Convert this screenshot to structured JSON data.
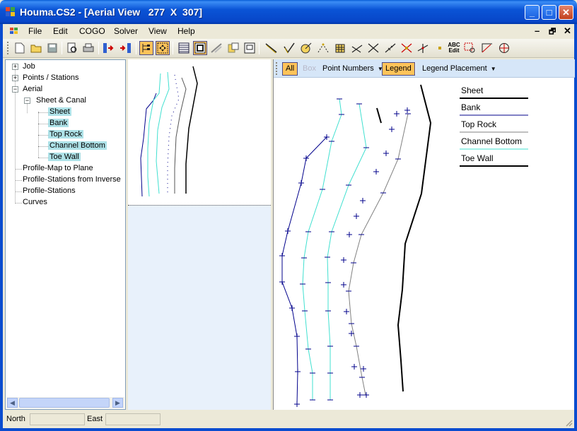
{
  "window": {
    "title": "Houma.CS2 - [Aerial View   277  X  307]",
    "controls": {
      "minimize": "_",
      "maximize": "□",
      "close": "✕"
    }
  },
  "menu": [
    "File",
    "Edit",
    "COGO",
    "Solver",
    "View",
    "Help"
  ],
  "mdi_controls": {
    "minimize": "–",
    "restore": "🗗",
    "close": "✕"
  },
  "toolbar_icons": [
    "new-icon",
    "open-icon",
    "save-icon",
    "print-preview-icon",
    "print-icon",
    "import-icon",
    "export-icon",
    "tree-view-icon",
    "extents-icon",
    "grid-icon",
    "aerial-icon",
    "profile-icon",
    "plan-icon",
    "window-icon",
    "line-icon",
    "check-icon",
    "compass-icon",
    "points-icon",
    "grid-point-icon",
    "angle-icon",
    "cross-icon",
    "measure-icon",
    "intersect-icon",
    "perpendicular-icon",
    "dot-icon",
    "edit-text-icon",
    "zoom-window-icon",
    "arc-icon",
    "circle-icon"
  ],
  "tree": {
    "items": [
      {
        "label": "Job",
        "expander": "+"
      },
      {
        "label": "Points / Stations",
        "expander": "+"
      },
      {
        "label": "Aerial",
        "expander": "−"
      },
      {
        "label": "Sheet & Canal",
        "expander": "−"
      },
      {
        "label": "Sheet",
        "selected": true
      },
      {
        "label": "Bank",
        "selected": true
      },
      {
        "label": "Top Rock",
        "selected": true
      },
      {
        "label": "Channel Bottom",
        "selected": true
      },
      {
        "label": "Toe Wall",
        "selected": true
      },
      {
        "label": "Profile-Map to Plane"
      },
      {
        "label": "Profile-Stations from Inverse"
      },
      {
        "label": "Profile-Stations"
      },
      {
        "label": "Curves"
      }
    ]
  },
  "view_toolbar": {
    "all": "All",
    "box": "Box",
    "point_numbers": "Point Numbers",
    "legend": "Legend",
    "legend_placement": "Legend Placement"
  },
  "legend": [
    {
      "label": "Sheet",
      "color": "#000000",
      "weight": 2
    },
    {
      "label": "Bank",
      "color": "#00008b",
      "weight": 1
    },
    {
      "label": "Top Rock",
      "color": "#808080",
      "weight": 1
    },
    {
      "label": "Channel Bottom",
      "color": "#40e0d0",
      "weight": 1
    },
    {
      "label": "Toe Wall",
      "color": "#000000",
      "weight": 2
    }
  ],
  "status": {
    "north_label": "North",
    "north_value": "",
    "east_label": "East",
    "east_value": ""
  }
}
